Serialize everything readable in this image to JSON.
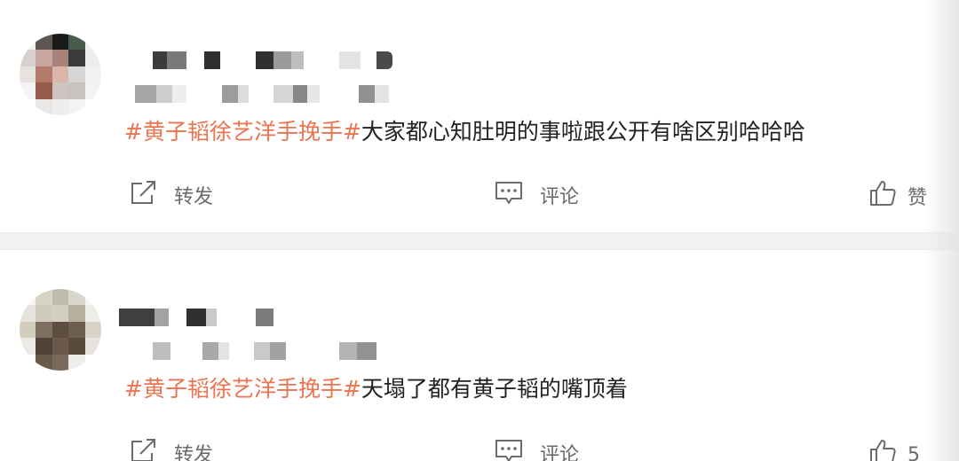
{
  "posts": [
    {
      "topic": "#黄子韬徐艺洋手挽手#",
      "text": "大家都心知肚明的事啦跟公开有啥区别哈哈哈",
      "actions": {
        "repost": "转发",
        "comment": "评论",
        "like": "赞"
      }
    },
    {
      "topic": "#黄子韬徐艺洋手挽手#",
      "text": "天塌了都有黄子韬的嘴顶着",
      "actions": {
        "repost": "转发",
        "comment": "评论",
        "like_count": "5"
      }
    }
  ],
  "icons": {
    "repost": "share-box-arrow-icon",
    "comment": "comment-bubble-icon",
    "like": "thumbs-up-icon"
  },
  "colors": {
    "topic": "#eb7350",
    "body_text": "#222222",
    "action_text": "#6b6b6b",
    "separator": "#f2f2f2"
  }
}
